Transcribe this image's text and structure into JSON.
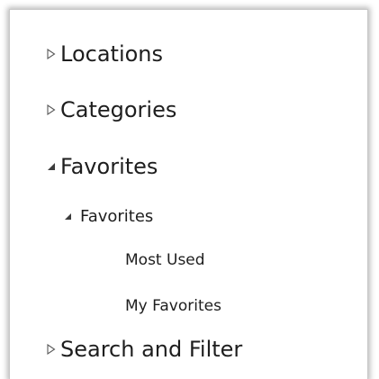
{
  "tree": {
    "items": [
      {
        "label": "Locations",
        "state": "collapsed",
        "icon": "triangle-right-outline-icon"
      },
      {
        "label": "Categories",
        "state": "collapsed",
        "icon": "triangle-right-outline-icon"
      },
      {
        "label": "Favorites",
        "state": "expanded",
        "icon": "triangle-expanded-icon",
        "children": [
          {
            "label": "Favorites",
            "state": "expanded",
            "icon": "triangle-expanded-icon",
            "children": [
              {
                "label": "Most Used"
              },
              {
                "label": "My Favorites"
              }
            ]
          }
        ]
      },
      {
        "label": "Search and Filter",
        "state": "collapsed",
        "icon": "triangle-right-outline-icon"
      }
    ]
  },
  "colors": {
    "text": "#1e1e1e",
    "expander": "#5a5a5a",
    "background": "#ffffff",
    "border": "#c9c9c9"
  }
}
